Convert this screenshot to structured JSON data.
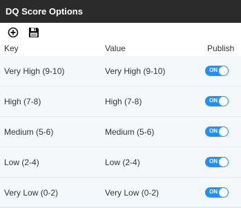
{
  "title": "DQ Score Options",
  "toolbar": {
    "add_icon": "plus-circle-icon",
    "save_icon": "floppy-disk-icon"
  },
  "columns": {
    "key": "Key",
    "value": "Value",
    "publish": "Publish"
  },
  "rows": [
    {
      "key": "Very High (9-10)",
      "value": "Very High (9-10)",
      "publish": "ON"
    },
    {
      "key": "High (7-8)",
      "value": "High (7-8)",
      "publish": "ON"
    },
    {
      "key": "Medium (5-6)",
      "value": "Medium (5-6)",
      "publish": "ON"
    },
    {
      "key": "Low (2-4)",
      "value": "Low (2-4)",
      "publish": "ON"
    },
    {
      "key": "Very Low (0-2)",
      "value": "Very Low (0-2)",
      "publish": "ON"
    }
  ],
  "colors": {
    "header_bg": "#2b2b2b",
    "toggle_on": "#1e90ff",
    "row_alt": "#f4f8fb"
  }
}
